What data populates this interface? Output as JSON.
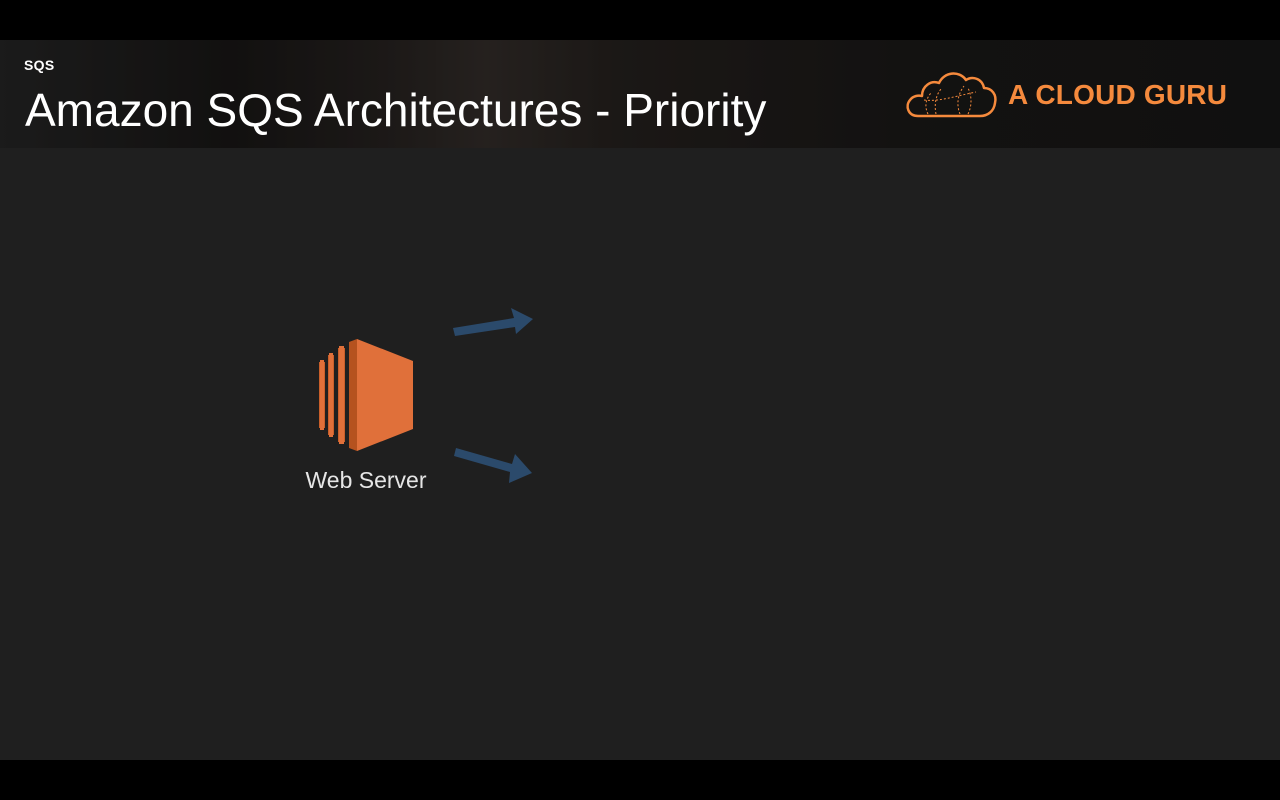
{
  "header": {
    "section": "SQS",
    "title": "Amazon SQS Architectures - Priority",
    "brand": {
      "name": "A CLOUD GURU",
      "logo_icon": "cloud-logo-icon",
      "color": "#f58a3d"
    }
  },
  "diagram": {
    "nodes": [
      {
        "label": "Web Server",
        "icon": "ec2-instance-icon",
        "color": "#e0703a"
      }
    ],
    "arrows": [
      {
        "name": "arrow-upper",
        "color": "#2b4a6b"
      },
      {
        "name": "arrow-lower",
        "color": "#2b4a6b"
      }
    ]
  },
  "colors": {
    "background": "#1f1f1f",
    "text": "#ffffff"
  }
}
